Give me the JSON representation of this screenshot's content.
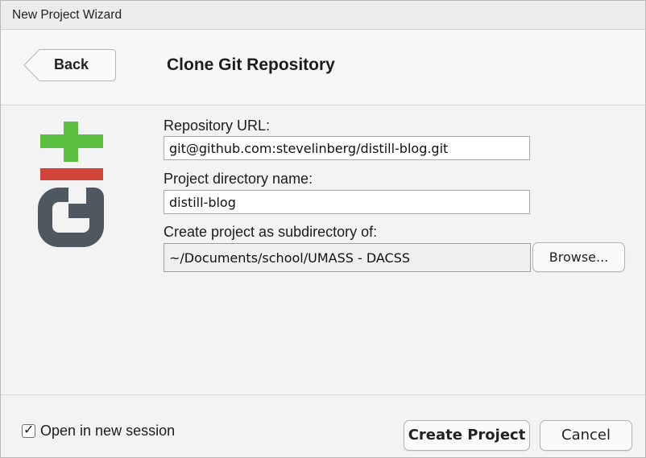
{
  "window": {
    "title": "New Project Wizard"
  },
  "header": {
    "back_label": "Back",
    "title": "Clone Git Repository"
  },
  "form": {
    "repo_url_label": "Repository URL:",
    "repo_url_value": "git@github.com:stevelinberg/distill-blog.git",
    "dir_name_label": "Project directory name:",
    "dir_name_value": "distill-blog",
    "subdir_label": "Create project as subdirectory of:",
    "subdir_value": "~/Documents/school/UMASS - DACSS",
    "browse_label": "Browse..."
  },
  "footer": {
    "open_new_session_label": "Open in new session",
    "open_new_session_checked": true,
    "check_glyph": "✓",
    "create_label": "Create Project",
    "cancel_label": "Cancel"
  },
  "colors": {
    "git_plus": "#5bbf3f",
    "git_minus": "#d0443a",
    "git_body": "#4e5860"
  },
  "icons": {
    "logo": "git-logo-icon",
    "back": "back-arrow-button"
  }
}
